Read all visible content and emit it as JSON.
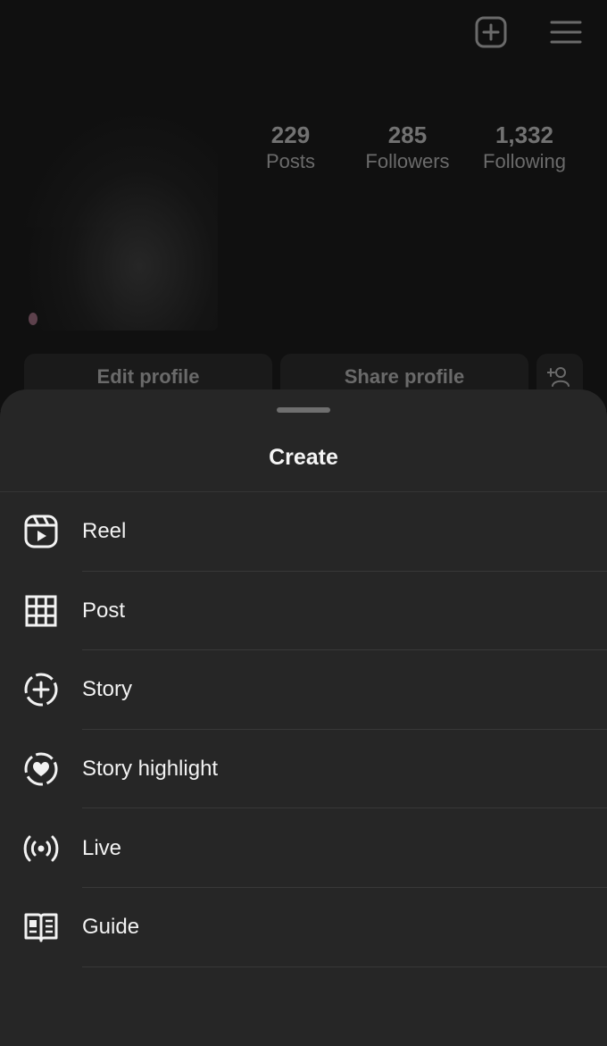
{
  "profile": {
    "stats": [
      {
        "number": "229",
        "label": "Posts"
      },
      {
        "number": "285",
        "label": "Followers"
      },
      {
        "number": "1,332",
        "label": "Following"
      }
    ],
    "buttons": {
      "edit": "Edit profile",
      "share": "Share profile"
    },
    "icons": {
      "create": "plus-square-icon",
      "menu": "hamburger-menu-icon",
      "add_user": "add-person-icon"
    }
  },
  "sheet": {
    "title": "Create",
    "items": [
      {
        "label": "Reel",
        "icon": "reel-icon"
      },
      {
        "label": "Post",
        "icon": "grid-icon"
      },
      {
        "label": "Story",
        "icon": "story-plus-icon"
      },
      {
        "label": "Story highlight",
        "icon": "story-highlight-heart-icon"
      },
      {
        "label": "Live",
        "icon": "live-broadcast-icon"
      },
      {
        "label": "Guide",
        "icon": "guide-book-icon"
      }
    ]
  },
  "colors": {
    "sheet_background": "#262626",
    "text": "#f2f2f2",
    "dimmed_text": "#6e6e6e"
  }
}
